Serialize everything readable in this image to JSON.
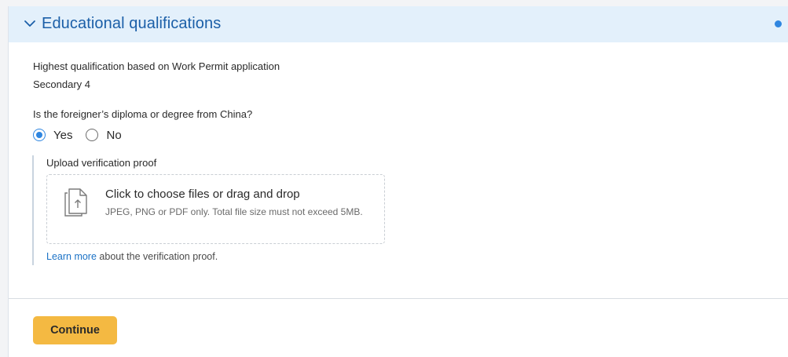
{
  "section": {
    "title": "Educational qualifications"
  },
  "qualification": {
    "label": "Highest qualification based on Work Permit application",
    "value": "Secondary 4"
  },
  "question": {
    "label": "Is the foreigner’s diploma or degree from China?",
    "options": [
      {
        "label": "Yes",
        "selected": true
      },
      {
        "label": "No",
        "selected": false
      }
    ]
  },
  "upload": {
    "label": "Upload verification proof",
    "title": "Click to choose files or drag and drop",
    "hint": "JPEG, PNG or PDF only. Total file size must not exceed 5MB.",
    "learn_link": "Learn more",
    "learn_suffix": " about the verification proof."
  },
  "actions": {
    "continue_label": "Continue"
  },
  "colors": {
    "header_bg": "#e3f0fb",
    "title": "#1b5fa8",
    "accent": "#2f86e0",
    "button": "#f4b942",
    "link": "#1b72c6"
  },
  "icons": {
    "header_chevron": "chevron-down-icon",
    "status": "status-dot",
    "upload": "file-upload-icon"
  }
}
